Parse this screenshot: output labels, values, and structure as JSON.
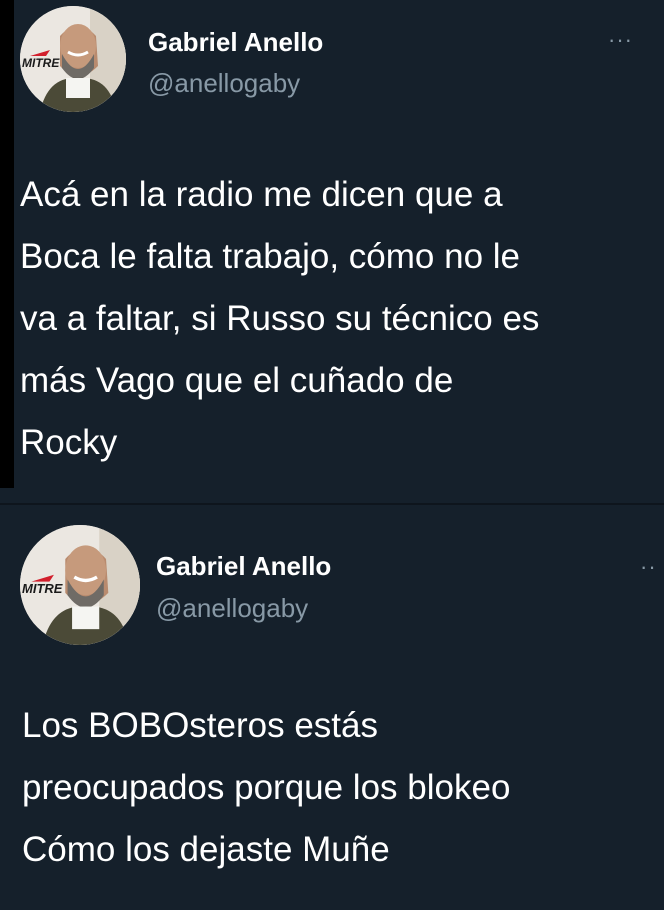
{
  "tweets": [
    {
      "author_name": "Gabriel Anello",
      "author_handle": "@anellogaby",
      "avatar_logo": "MITRE",
      "more_icon": "more-horizontal-icon",
      "lines": [
        "Acá en la radio me dicen que a",
        "Boca le falta trabajo, cómo no le",
        "va a faltar, si Russo su técnico es",
        "más Vago que el cuñado de",
        "Rocky"
      ]
    },
    {
      "author_name": "Gabriel Anello",
      "author_handle": "@anellogaby",
      "avatar_logo": "MITRE",
      "more_icon": "more-horizontal-icon",
      "lines": [
        "Los BOBOsteros estás",
        "preocupados porque los blokeo",
        "Cómo los dejaste Muñe"
      ]
    }
  ],
  "colors": {
    "background": "#15202b",
    "text": "#ffffff",
    "secondary_text": "#8899a6"
  }
}
